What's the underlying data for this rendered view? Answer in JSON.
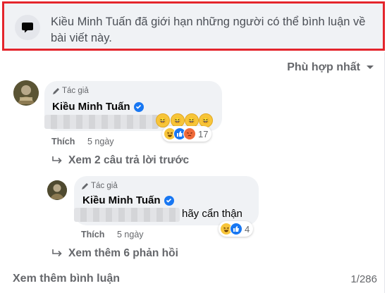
{
  "notice": {
    "text": "Kiều Minh Tuấn đã giới hạn những người có thể bình luận về bài viết này.",
    "icon": "comment-icon"
  },
  "sort": {
    "label": "Phù hợp nhất",
    "icon": "caret-down-icon"
  },
  "comments": [
    {
      "author_tag": "Tác giả",
      "author": "Kiều Minh Tuấn",
      "verified": true,
      "text_blurred": true,
      "emoji": [
        "😆",
        "😆",
        "😆",
        "😆"
      ],
      "reactions": [
        "haha",
        "like",
        "angry"
      ],
      "reaction_count": "17",
      "action_like": "Thích",
      "time": "5 ngày"
    },
    {
      "author_tag": "Tác giả",
      "author": "Kiều Minh Tuấn",
      "verified": true,
      "text_suffix": "hãy cẩn thận",
      "reactions": [
        "haha",
        "like"
      ],
      "reaction_count": "4",
      "action_like": "Thích",
      "time": "5 ngày"
    }
  ],
  "view_previous_replies": "Xem 2 câu trả lời trước",
  "view_more_replies": "Xem thêm 6 phản hồi",
  "footer": {
    "view_more_comments": "Xem thêm bình luận",
    "count": "1/286"
  },
  "colors": {
    "highlight_border": "#e4252c",
    "bubble": "#f0f2f5",
    "secondary_text": "#65676b",
    "verified": "#1877f2"
  }
}
